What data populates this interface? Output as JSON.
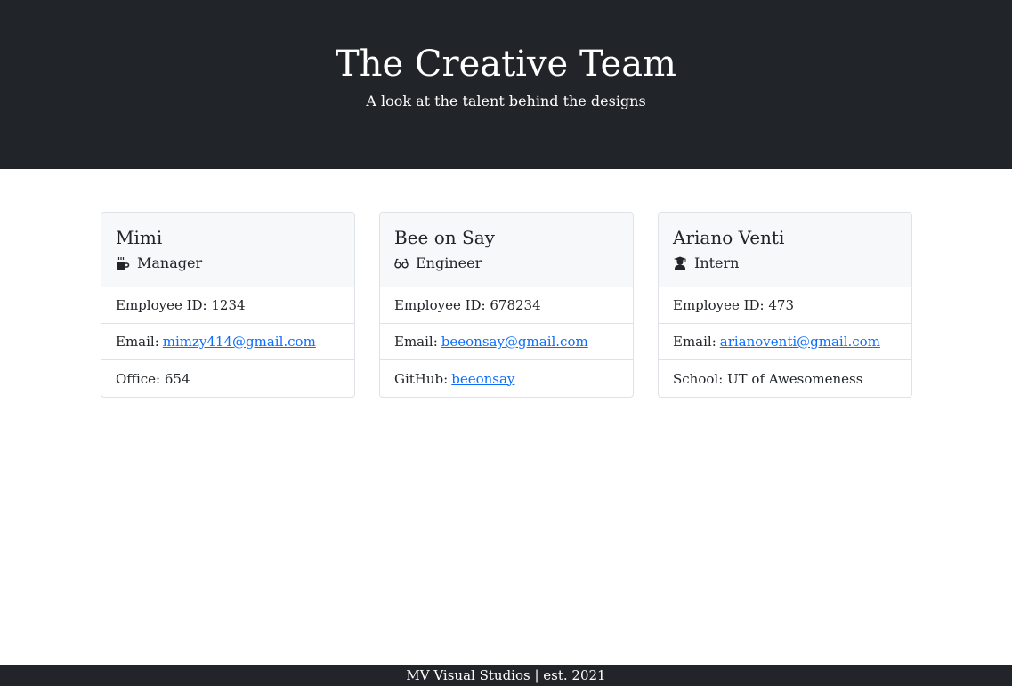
{
  "hero": {
    "title": "The Creative Team",
    "subtitle": "A look at the talent behind the designs"
  },
  "cards": [
    {
      "name": "Mimi",
      "role": "Manager",
      "role_icon": "mug-icon",
      "id_label": "Employee ID: 1234",
      "email_prefix": "Email:",
      "email": "mimzy414@gmail.com",
      "extra_label": "Office: 654"
    },
    {
      "name": "Bee on Say",
      "role": "Engineer",
      "role_icon": "glasses-icon",
      "id_label": "Employee ID: 678234",
      "email_prefix": "Email:",
      "email": "beeonsay@gmail.com",
      "extra_prefix": "GitHub:",
      "extra_link": "beeonsay"
    },
    {
      "name": "Ariano Venti",
      "role": "Intern",
      "role_icon": "graduate-icon",
      "id_label": "Employee ID: 473",
      "email_prefix": "Email:",
      "email": "arianoventi@gmail.com",
      "extra_label": "School: UT of Awesomeness"
    }
  ],
  "footer": {
    "text": "MV Visual Studios | est. 2021"
  },
  "colors": {
    "dark": "#212529",
    "link": "#0d6efd",
    "card_header": "#f7f8fa"
  }
}
